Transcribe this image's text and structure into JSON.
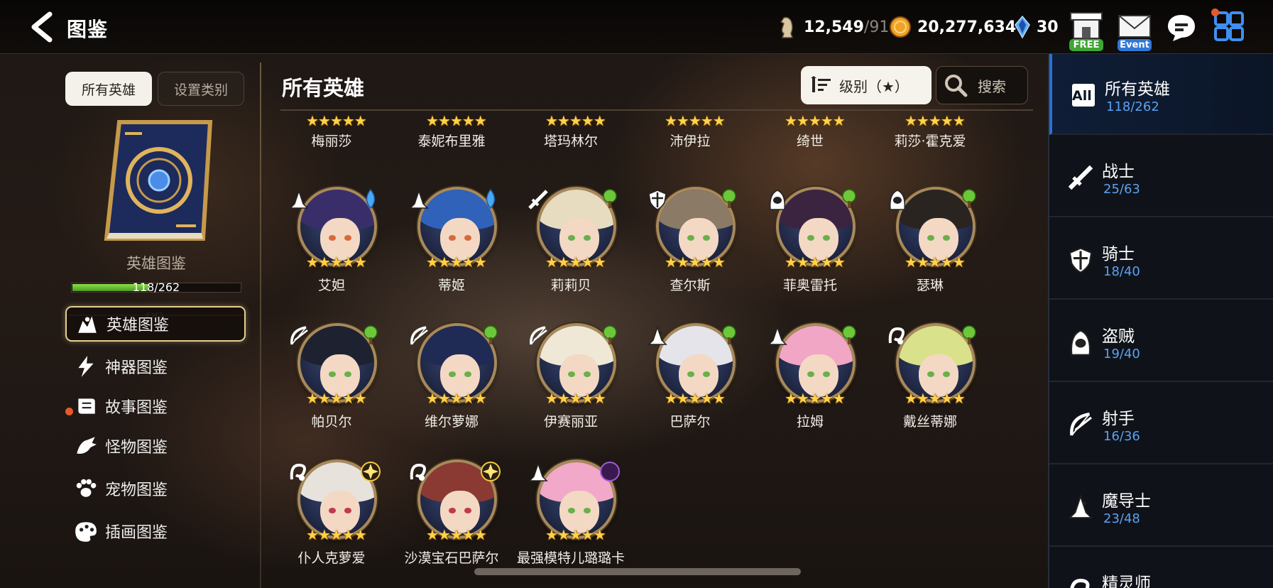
{
  "header": {
    "title": "图鉴",
    "stamina_value": "12,549",
    "stamina_max": "/91",
    "gold": "20,277,634",
    "crystals": "30",
    "free_label": "FREE",
    "event_label": "Event"
  },
  "left": {
    "tab_all": "所有英雄",
    "tab_category": "设置类别",
    "book_title": "英雄图鉴",
    "progress_text": "118/262",
    "progress_fraction": 0.45,
    "menu": [
      {
        "label": "英雄图鉴",
        "icon": "hero-codex-icon",
        "active": true
      },
      {
        "label": "神器图鉴",
        "icon": "artifact-lightning-icon"
      },
      {
        "label": "故事图鉴",
        "icon": "story-scroll-icon",
        "badge": true
      },
      {
        "label": "怪物图鉴",
        "icon": "monster-dragon-icon"
      },
      {
        "label": "宠物图鉴",
        "icon": "pet-paw-icon"
      },
      {
        "label": "插画图鉴",
        "icon": "illustration-palette-icon"
      }
    ]
  },
  "main": {
    "title": "所有英雄",
    "sort_label": "级别（★）",
    "search_label": "搜索",
    "partial_row": [
      "梅丽莎",
      "泰妮布里雅",
      "塔玛林尔",
      "沛伊拉",
      "绮世",
      "莉莎·霍克爱"
    ],
    "rows": [
      [
        {
          "name": "艾妲",
          "class": "mage",
          "element": "water",
          "hair": "#3a2e6a"
        },
        {
          "name": "蒂姬",
          "class": "mage",
          "element": "water",
          "hair": "#2f62b8"
        },
        {
          "name": "莉莉贝",
          "class": "warrior",
          "element": "nature",
          "hair": "#e8dcc0"
        },
        {
          "name": "查尔斯",
          "class": "knight",
          "element": "nature",
          "hair": "#8a7a66"
        },
        {
          "name": "菲奥雷托",
          "class": "thief",
          "element": "nature",
          "hair": "#3b2440"
        },
        {
          "name": "瑟琳",
          "class": "thief",
          "element": "nature",
          "hair": "#2a2420"
        }
      ],
      [
        {
          "name": "帕贝尔",
          "class": "ranger",
          "element": "nature",
          "hair": "#1e2230"
        },
        {
          "name": "维尔萝娜",
          "class": "ranger",
          "element": "nature",
          "hair": "#1f2a55"
        },
        {
          "name": "伊赛丽亚",
          "class": "ranger",
          "element": "nature",
          "hair": "#efe8d6"
        },
        {
          "name": "巴萨尔",
          "class": "mage",
          "element": "nature",
          "hair": "#e4e4ea"
        },
        {
          "name": "拉姆",
          "class": "mage",
          "element": "nature",
          "hair": "#f0a6c4"
        },
        {
          "name": "戴丝蒂娜",
          "class": "soul-weaver",
          "element": "nature",
          "hair": "#d9e28a"
        }
      ],
      [
        {
          "name": "仆人克萝爱",
          "class": "soul-weaver",
          "element": "light",
          "hair": "#e8e2dc"
        },
        {
          "name": "沙漠宝石巴萨尔",
          "class": "soul-weaver",
          "element": "light",
          "hair": "#8a3a32"
        },
        {
          "name": "最强模特儿璐璐卡",
          "class": "mage",
          "element": "dark",
          "hair": "#f2a8c8"
        }
      ]
    ],
    "stars": "★★★★★"
  },
  "categories": [
    {
      "name": "所有英雄",
      "count": "118/262",
      "icon": "all-icon",
      "all_label": "All"
    },
    {
      "name": "战士",
      "count": "25/63",
      "icon": "warrior-sword-icon"
    },
    {
      "name": "骑士",
      "count": "18/40",
      "icon": "knight-shield-icon"
    },
    {
      "name": "盗贼",
      "count": "19/40",
      "icon": "thief-hood-icon"
    },
    {
      "name": "射手",
      "count": "16/36",
      "icon": "ranger-bow-icon"
    },
    {
      "name": "魔导士",
      "count": "23/48",
      "icon": "mage-hat-icon"
    },
    {
      "name": "精灵师",
      "count": "",
      "icon": "soul-weaver-icon"
    }
  ]
}
